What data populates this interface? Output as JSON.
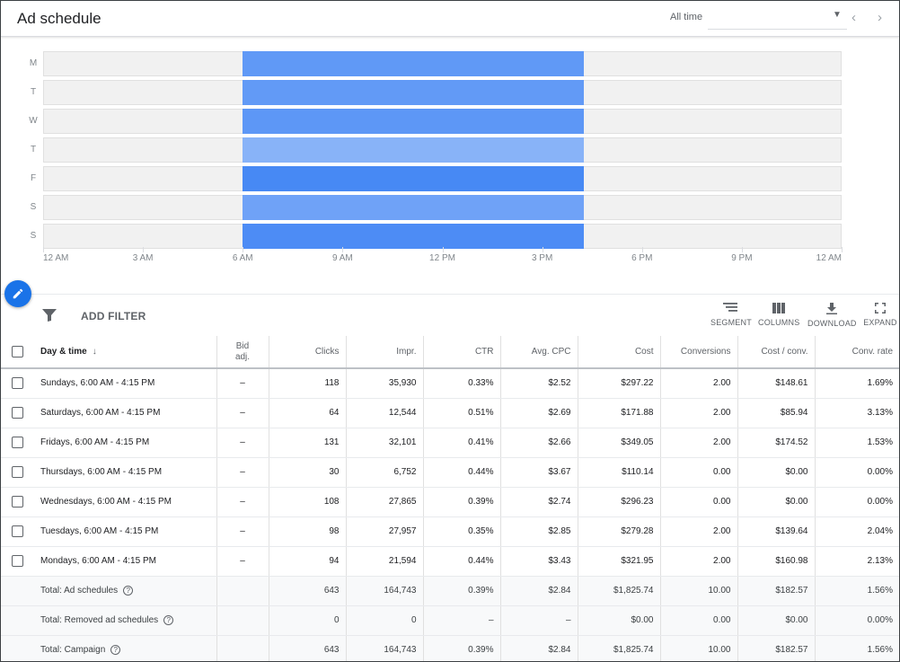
{
  "header": {
    "title": "Ad schedule",
    "date_range": "All time",
    "icons": [
      "dropdown-caret-icon",
      "chevron-left-icon",
      "chevron-right-icon"
    ]
  },
  "chart_data": {
    "type": "heatmap",
    "title": "",
    "rows": [
      "M",
      "T",
      "W",
      "T",
      "F",
      "S",
      "S"
    ],
    "x_ticks": [
      "12 AM",
      "3 AM",
      "6 AM",
      "9 AM",
      "12 PM",
      "3 PM",
      "6 PM",
      "9 PM",
      "12 AM"
    ],
    "x_range_hours": [
      0,
      24
    ],
    "scheduled_window_hours": [
      6,
      16.25
    ],
    "intensity": [
      0.72,
      0.7,
      0.75,
      0.35,
      0.95,
      0.58,
      0.9
    ],
    "colors": {
      "empty": "#f1f1f1",
      "scale_low": "#aecbfa",
      "scale_high": "#4285f4"
    }
  },
  "toolbar": {
    "add_filter": "ADD FILTER",
    "segment": "SEGMENT",
    "columns": "COLUMNS",
    "download": "DOWNLOAD",
    "expand": "EXPAND"
  },
  "table": {
    "headers": {
      "day_time": "Day & time",
      "bid_adj_line1": "Bid",
      "bid_adj_line2": "adj.",
      "clicks": "Clicks",
      "impr": "Impr.",
      "ctr": "CTR",
      "avg_cpc": "Avg. CPC",
      "cost": "Cost",
      "conversions": "Conversions",
      "cost_conv": "Cost / conv.",
      "conv_rate": "Conv. rate"
    },
    "rows": [
      {
        "day_time": "Sundays, 6:00 AM - 4:15 PM",
        "bid_adj": "–",
        "clicks": "118",
        "impr": "35,930",
        "ctr": "0.33%",
        "avg_cpc": "$2.52",
        "cost": "$297.22",
        "conversions": "2.00",
        "cost_conv": "$148.61",
        "conv_rate": "1.69%"
      },
      {
        "day_time": "Saturdays, 6:00 AM - 4:15 PM",
        "bid_adj": "–",
        "clicks": "64",
        "impr": "12,544",
        "ctr": "0.51%",
        "avg_cpc": "$2.69",
        "cost": "$171.88",
        "conversions": "2.00",
        "cost_conv": "$85.94",
        "conv_rate": "3.13%"
      },
      {
        "day_time": "Fridays, 6:00 AM - 4:15 PM",
        "bid_adj": "–",
        "clicks": "131",
        "impr": "32,101",
        "ctr": "0.41%",
        "avg_cpc": "$2.66",
        "cost": "$349.05",
        "conversions": "2.00",
        "cost_conv": "$174.52",
        "conv_rate": "1.53%"
      },
      {
        "day_time": "Thursdays, 6:00 AM - 4:15 PM",
        "bid_adj": "–",
        "clicks": "30",
        "impr": "6,752",
        "ctr": "0.44%",
        "avg_cpc": "$3.67",
        "cost": "$110.14",
        "conversions": "0.00",
        "cost_conv": "$0.00",
        "conv_rate": "0.00%"
      },
      {
        "day_time": "Wednesdays, 6:00 AM - 4:15 PM",
        "bid_adj": "–",
        "clicks": "108",
        "impr": "27,865",
        "ctr": "0.39%",
        "avg_cpc": "$2.74",
        "cost": "$296.23",
        "conversions": "0.00",
        "cost_conv": "$0.00",
        "conv_rate": "0.00%"
      },
      {
        "day_time": "Tuesdays, 6:00 AM - 4:15 PM",
        "bid_adj": "–",
        "clicks": "98",
        "impr": "27,957",
        "ctr": "0.35%",
        "avg_cpc": "$2.85",
        "cost": "$279.28",
        "conversions": "2.00",
        "cost_conv": "$139.64",
        "conv_rate": "2.04%"
      },
      {
        "day_time": "Mondays, 6:00 AM - 4:15 PM",
        "bid_adj": "–",
        "clicks": "94",
        "impr": "21,594",
        "ctr": "0.44%",
        "avg_cpc": "$3.43",
        "cost": "$321.95",
        "conversions": "2.00",
        "cost_conv": "$160.98",
        "conv_rate": "2.13%"
      }
    ],
    "totals": [
      {
        "label": "Total: Ad schedules",
        "clicks": "643",
        "impr": "164,743",
        "ctr": "0.39%",
        "avg_cpc": "$2.84",
        "cost": "$1,825.74",
        "conversions": "10.00",
        "cost_conv": "$182.57",
        "conv_rate": "1.56%"
      },
      {
        "label": "Total: Removed ad schedules",
        "clicks": "0",
        "impr": "0",
        "ctr": "–",
        "avg_cpc": "–",
        "cost": "$0.00",
        "conversions": "0.00",
        "cost_conv": "$0.00",
        "conv_rate": "0.00%"
      },
      {
        "label": "Total: Campaign",
        "clicks": "643",
        "impr": "164,743",
        "ctr": "0.39%",
        "avg_cpc": "$2.84",
        "cost": "$1,825.74",
        "conversions": "10.00",
        "cost_conv": "$182.57",
        "conv_rate": "1.56%"
      }
    ]
  },
  "colors": {
    "accent": "#1a73e8",
    "chart_blue": "#4285f4"
  }
}
